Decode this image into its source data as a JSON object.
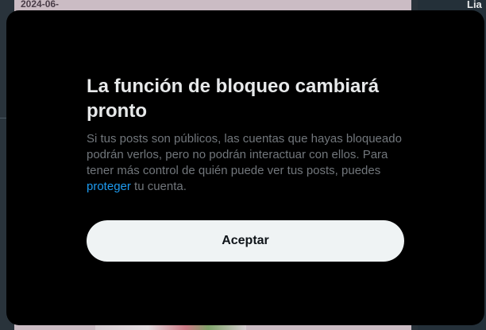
{
  "background": {
    "date_text": "2024-06-",
    "right_label": "Lia"
  },
  "dialog": {
    "title": "La función de bloqueo cambiará pronto",
    "description_before_link": "Si tus posts son públicos, las cuentas que hayas bloqueado podrán verlos, pero no podrán interactuar con ellos. Para tener más control de quién puede ver tus posts, puedes ",
    "link_text": "proteger",
    "description_after_link": " tu cuenta.",
    "accept_label": "Aceptar"
  },
  "colors": {
    "modal_bg": "#000000",
    "title": "#e7e9ea",
    "body_text": "#71767b",
    "link": "#1d9bf0",
    "button_bg": "#eff3f4",
    "button_text": "#0f1419"
  }
}
